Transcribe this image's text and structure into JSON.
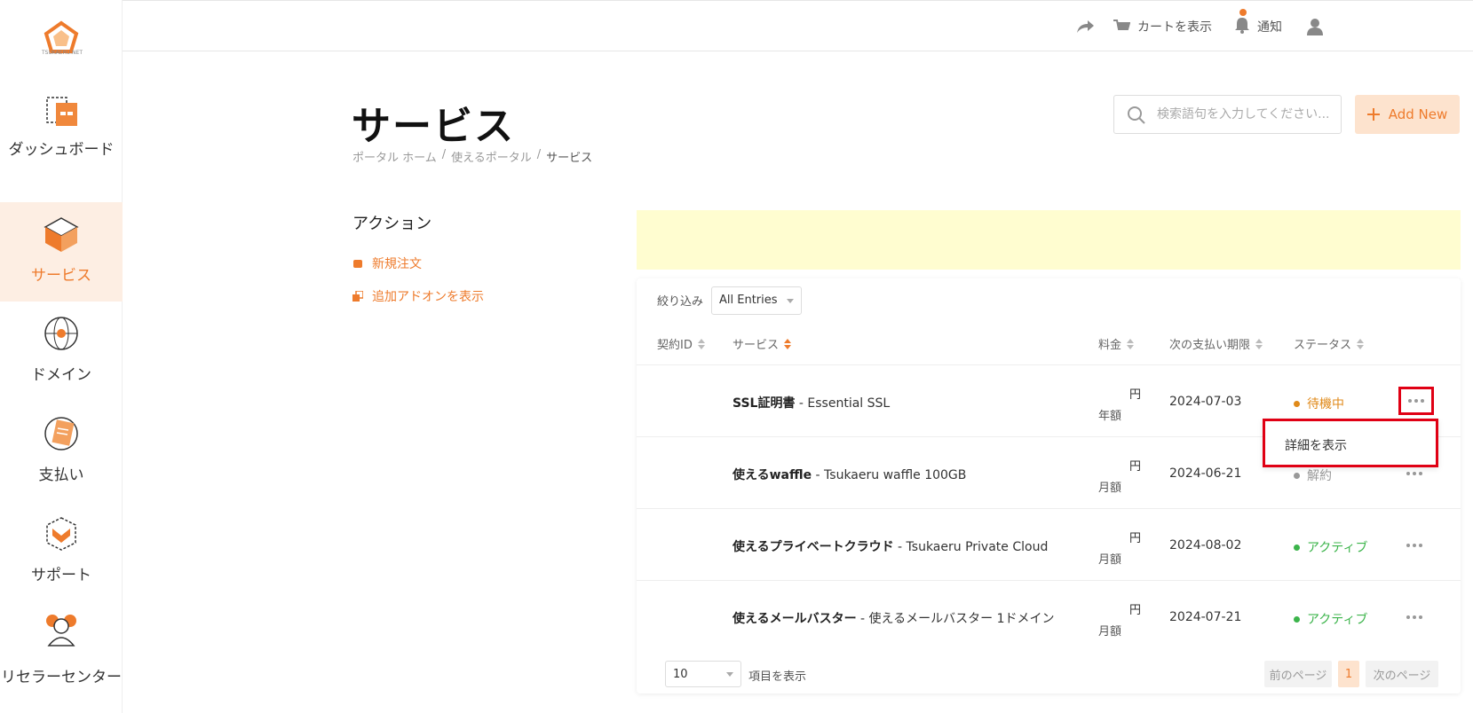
{
  "sidebar": {
    "logo_text": "TSUKAERU.NET",
    "items": [
      {
        "label": "ダッシュボード",
        "icon": "dashboard-icon"
      },
      {
        "label": "サービス",
        "icon": "box-icon"
      },
      {
        "label": "ドメイン",
        "icon": "globe-icon"
      },
      {
        "label": "支払い",
        "icon": "payment-icon"
      },
      {
        "label": "サポート",
        "icon": "support-icon"
      },
      {
        "label": "リセラーセンター",
        "icon": "reseller-icon"
      }
    ]
  },
  "topbar": {
    "cart_label": "カートを表示",
    "notify_label": "通知"
  },
  "header": {
    "title": "サービス",
    "breadcrumb": [
      "ポータル ホーム",
      "使えるポータル",
      "サービス"
    ],
    "search_placeholder": "検索語句を入力してください...",
    "add_new_label": "Add New"
  },
  "actions": {
    "title": "アクション",
    "links": [
      "新規注文",
      "追加アドオンを表示"
    ]
  },
  "table": {
    "filter_label": "絞り込み",
    "filter_value": "All Entries",
    "columns": [
      "契約ID",
      "サービス",
      "料金",
      "次の支払い期限",
      "ステータス"
    ],
    "rows": [
      {
        "product": "SSL証明書",
        "detail": " - Essential SSL",
        "yen": "円",
        "cycle": "年額",
        "due": "2024-07-03",
        "status": "待機中",
        "status_color": "#e08a1a"
      },
      {
        "product": "使えるwaffle",
        "detail": " - Tsukaeru waffle 100GB",
        "yen": "円",
        "cycle": "月額",
        "due": "2024-06-21",
        "status": "解約",
        "status_color": "#999999"
      },
      {
        "product": "使えるプライベートクラウド",
        "detail": " - Tsukaeru Private Cloud",
        "yen": "円",
        "cycle": "月額",
        "due": "2024-08-02",
        "status": "アクティブ",
        "status_color": "#3cb44b"
      },
      {
        "product": "使えるメールバスター",
        "detail": " - 使えるメールバスター 1ドメイン",
        "yen": "円",
        "cycle": "月額",
        "due": "2024-07-21",
        "status": "アクティブ",
        "status_color": "#3cb44b"
      }
    ],
    "dropdown_item": "詳細を表示",
    "per_page_value": "10",
    "per_page_label": "項目を表示",
    "prev_label": "前のページ",
    "page_current": "1",
    "next_label": "次のページ"
  },
  "colors": {
    "accent": "#ee7b2c",
    "highlight": "#e00014"
  }
}
